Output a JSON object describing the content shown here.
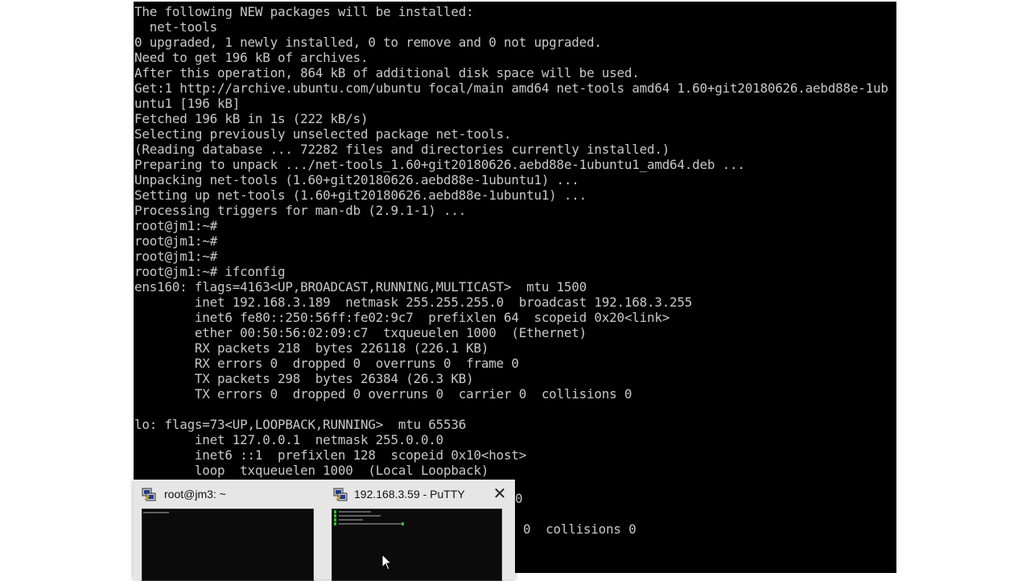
{
  "terminal": {
    "lines": [
      "The following NEW packages will be installed:",
      "  net-tools",
      "0 upgraded, 1 newly installed, 0 to remove and 0 not upgraded.",
      "Need to get 196 kB of archives.",
      "After this operation, 864 kB of additional disk space will be used.",
      "Get:1 http://archive.ubuntu.com/ubuntu focal/main amd64 net-tools amd64 1.60+git20180626.aebd88e-1ub",
      "untu1 [196 kB]",
      "Fetched 196 kB in 1s (222 kB/s)",
      "Selecting previously unselected package net-tools.",
      "(Reading database ... 72282 files and directories currently installed.)",
      "Preparing to unpack .../net-tools_1.60+git20180626.aebd88e-1ubuntu1_amd64.deb ...",
      "Unpacking net-tools (1.60+git20180626.aebd88e-1ubuntu1) ...",
      "Setting up net-tools (1.60+git20180626.aebd88e-1ubuntu1) ...",
      "Processing triggers for man-db (2.9.1-1) ...",
      "root@jm1:~#",
      "root@jm1:~#",
      "root@jm1:~#",
      "root@jm1:~# ifconfig",
      "ens160: flags=4163<UP,BROADCAST,RUNNING,MULTICAST>  mtu 1500",
      "        inet 192.168.3.189  netmask 255.255.255.0  broadcast 192.168.3.255",
      "        inet6 fe80::250:56ff:fe02:9c7  prefixlen 64  scopeid 0x20<link>",
      "        ether 00:50:56:02:09:c7  txqueuelen 1000  (Ethernet)",
      "        RX packets 218  bytes 226118 (226.1 KB)",
      "        RX errors 0  dropped 0  overruns 0  frame 0",
      "        TX packets 298  bytes 26384 (26.3 KB)",
      "        TX errors 0  dropped 0 overruns 0  carrier 0  collisions 0",
      "",
      "lo: flags=73<UP,LOOPBACK,RUNNING>  mtu 65536",
      "        inet 127.0.0.1  netmask 255.0.0.0",
      "        inet6 ::1  prefixlen 128  scopeid 0x10<host>",
      "        loop  txqueuelen 1000  (Local Loopback)"
    ],
    "hidden_tail": [
      "0",
      "0  collisions 0"
    ]
  },
  "taskbar_previews": [
    {
      "title": "root@jm3: ~",
      "icon": "putty-icon"
    },
    {
      "title": "192.168.3.59 - PuTTY",
      "icon": "putty-icon",
      "close": "✕"
    }
  ]
}
